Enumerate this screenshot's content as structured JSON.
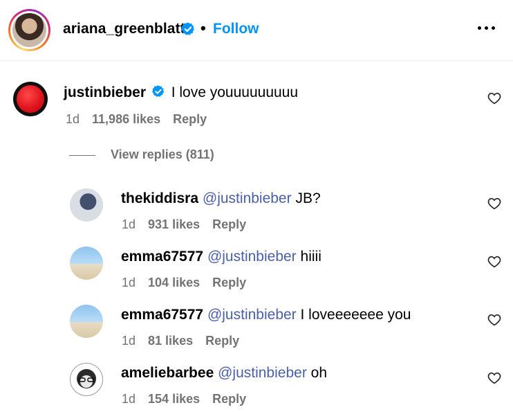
{
  "post": {
    "username": "ariana_greenblatt",
    "separator": "•",
    "follow_label": "Follow"
  },
  "colors": {
    "link": "#0095f6",
    "mention": "#4a5fa8",
    "meta": "#737373",
    "verified": "#0095f6"
  },
  "comment": {
    "username": "justinbieber",
    "text": "I love youuuuuuuuu",
    "age": "1d",
    "likes": "11,986 likes",
    "reply_label": "Reply"
  },
  "view_replies": "View replies (811)",
  "replies": [
    {
      "username": "thekiddisra",
      "mention": "@justinbieber",
      "text": "JB?",
      "age": "1d",
      "likes": "931 likes",
      "reply_label": "Reply"
    },
    {
      "username": "emma67577",
      "mention": "@justinbieber",
      "text": "hiiii",
      "age": "1d",
      "likes": "104 likes",
      "reply_label": "Reply"
    },
    {
      "username": "emma67577",
      "mention": "@justinbieber",
      "text": "I loveeeeeee you",
      "age": "1d",
      "likes": "81 likes",
      "reply_label": "Reply"
    },
    {
      "username": "ameliebarbee",
      "mention": "@justinbieber",
      "text": "oh",
      "age": "1d",
      "likes": "154 likes",
      "reply_label": "Reply"
    }
  ]
}
